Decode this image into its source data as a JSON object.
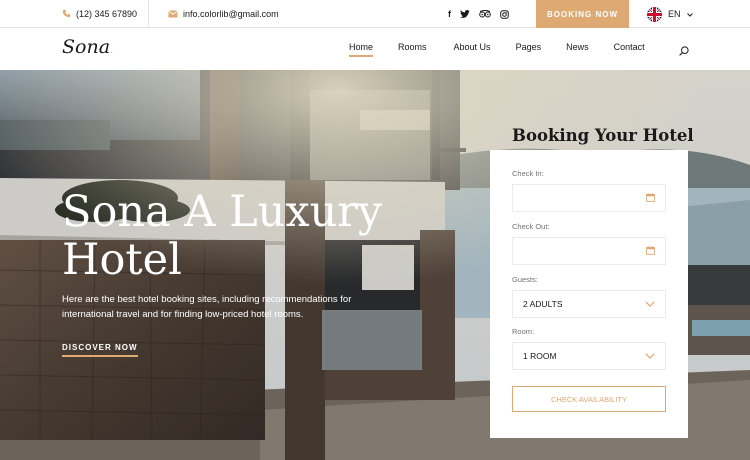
{
  "topbar": {
    "phone": "(12) 345 67890",
    "email": "info.colorlib@gmail.com",
    "booking_button": "BOOKING NOW",
    "language": "EN"
  },
  "header": {
    "logo": "Sona",
    "nav": [
      {
        "label": "Home",
        "active": true
      },
      {
        "label": "Rooms"
      },
      {
        "label": "About Us"
      },
      {
        "label": "Pages"
      },
      {
        "label": "News"
      },
      {
        "label": "Contact"
      }
    ]
  },
  "hero": {
    "title": "Sona A Luxury Hotel",
    "description": "Here are the best hotel booking sites, including recommendations for international travel and for finding low-priced hotel rooms.",
    "cta": "DISCOVER NOW"
  },
  "booking": {
    "title": "Booking Your Hotel",
    "check_in_label": "Check In:",
    "check_out_label": "Check Out:",
    "guests_label": "Guests:",
    "guests_value": "2 ADULTS",
    "room_label": "Room:",
    "room_value": "1 ROOM",
    "submit": "CHECK AVAILABILITY"
  },
  "colors": {
    "accent": "#dfa974",
    "text": "#19191a"
  },
  "icons": [
    "phone-icon",
    "mail-icon",
    "facebook-icon",
    "twitter-icon",
    "tripadvisor-icon",
    "instagram-icon",
    "uk-flag-icon",
    "chevron-down-icon",
    "search-icon",
    "calendar-icon"
  ]
}
